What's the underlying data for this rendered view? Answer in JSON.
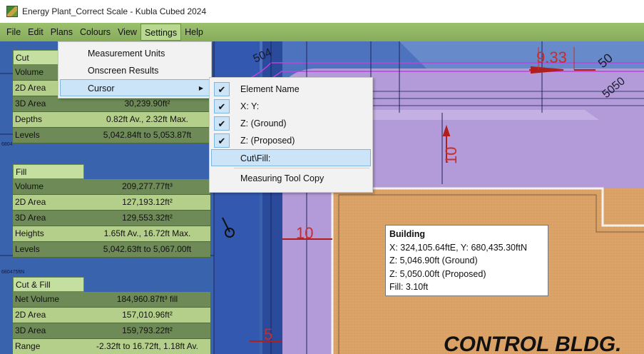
{
  "window": {
    "title": "Energy Plant_Correct Scale - Kubla Cubed 2024",
    "icon": "kubla-terrain-icon"
  },
  "menubar": [
    "File",
    "Edit",
    "Plans",
    "Colours",
    "View",
    "Settings",
    "Help"
  ],
  "active_menu": "Settings",
  "settings_menu": {
    "items": [
      "Measurement Units",
      "Onscreen Results",
      "Cursor"
    ],
    "highlighted": "Cursor"
  },
  "cursor_submenu": {
    "items": [
      {
        "label": "Element Name",
        "checked": true
      },
      {
        "label": "X: Y:",
        "checked": true
      },
      {
        "label": "Z: (Ground)",
        "checked": true
      },
      {
        "label": "Z: (Proposed)",
        "checked": true
      },
      {
        "label": "Cut\\Fill:",
        "checked": false,
        "highlighted": true
      },
      {
        "label": "Measuring Tool Copy",
        "checked": false
      }
    ]
  },
  "results": {
    "cut": {
      "title": "Cut",
      "rows": [
        {
          "label": "Volume",
          "value": ""
        },
        {
          "label": "2D Area",
          "value": ""
        },
        {
          "label": "3D Area",
          "value": "30,239.90ft²"
        },
        {
          "label": "Depths",
          "value": "0.82ft Av., 2.32ft Max."
        },
        {
          "label": "Levels",
          "value": "5,042.84ft to 5,053.87ft"
        }
      ]
    },
    "fill": {
      "title": "Fill",
      "rows": [
        {
          "label": "Volume",
          "value": "209,277.77ft³"
        },
        {
          "label": "2D Area",
          "value": "127,193.12ft²"
        },
        {
          "label": "3D Area",
          "value": "129,553.32ft²"
        },
        {
          "label": "Heights",
          "value": "1.65ft Av., 16.72ft Max."
        },
        {
          "label": "Levels",
          "value": "5,042.63ft to 5,067.00ft"
        }
      ]
    },
    "cutfill": {
      "title": "Cut & Fill",
      "rows": [
        {
          "label": "Net Volume",
          "value": "184,960.87ft³ fill"
        },
        {
          "label": "2D Area",
          "value": "157,010.96ft²"
        },
        {
          "label": "3D Area",
          "value": "159,793.22ft²"
        },
        {
          "label": "Range",
          "value": "-2.32ft to 16.72ft, 1.18ft Av."
        }
      ]
    }
  },
  "canvas": {
    "dims": {
      "d1": "9.33",
      "d2": "10",
      "d3": "10",
      "d4": "5"
    },
    "contours": {
      "c1": "504",
      "c2": "50",
      "c3": "5050",
      "c4": "50"
    },
    "grid_labels": {
      "g1": "680475ftN",
      "g2": "6804"
    },
    "building_label": "CONTROL BLDG."
  },
  "tooltip": {
    "name": "Building",
    "xy": "X: 324,105.64ftE, Y: 680,435.30ftN",
    "zg": "Z: 5,046.90ft (Ground)",
    "zp": "Z: 5,050.00ft (Proposed)",
    "fill": "Fill: 3.10ft"
  },
  "colors": {
    "menubar": "#8fb462",
    "terrain_blue": "#3a63ae",
    "pad_purple": "#b39ad8",
    "building_orange": "#dba367",
    "panel_dark": "#6e8b57",
    "panel_light": "#b4cf89"
  }
}
